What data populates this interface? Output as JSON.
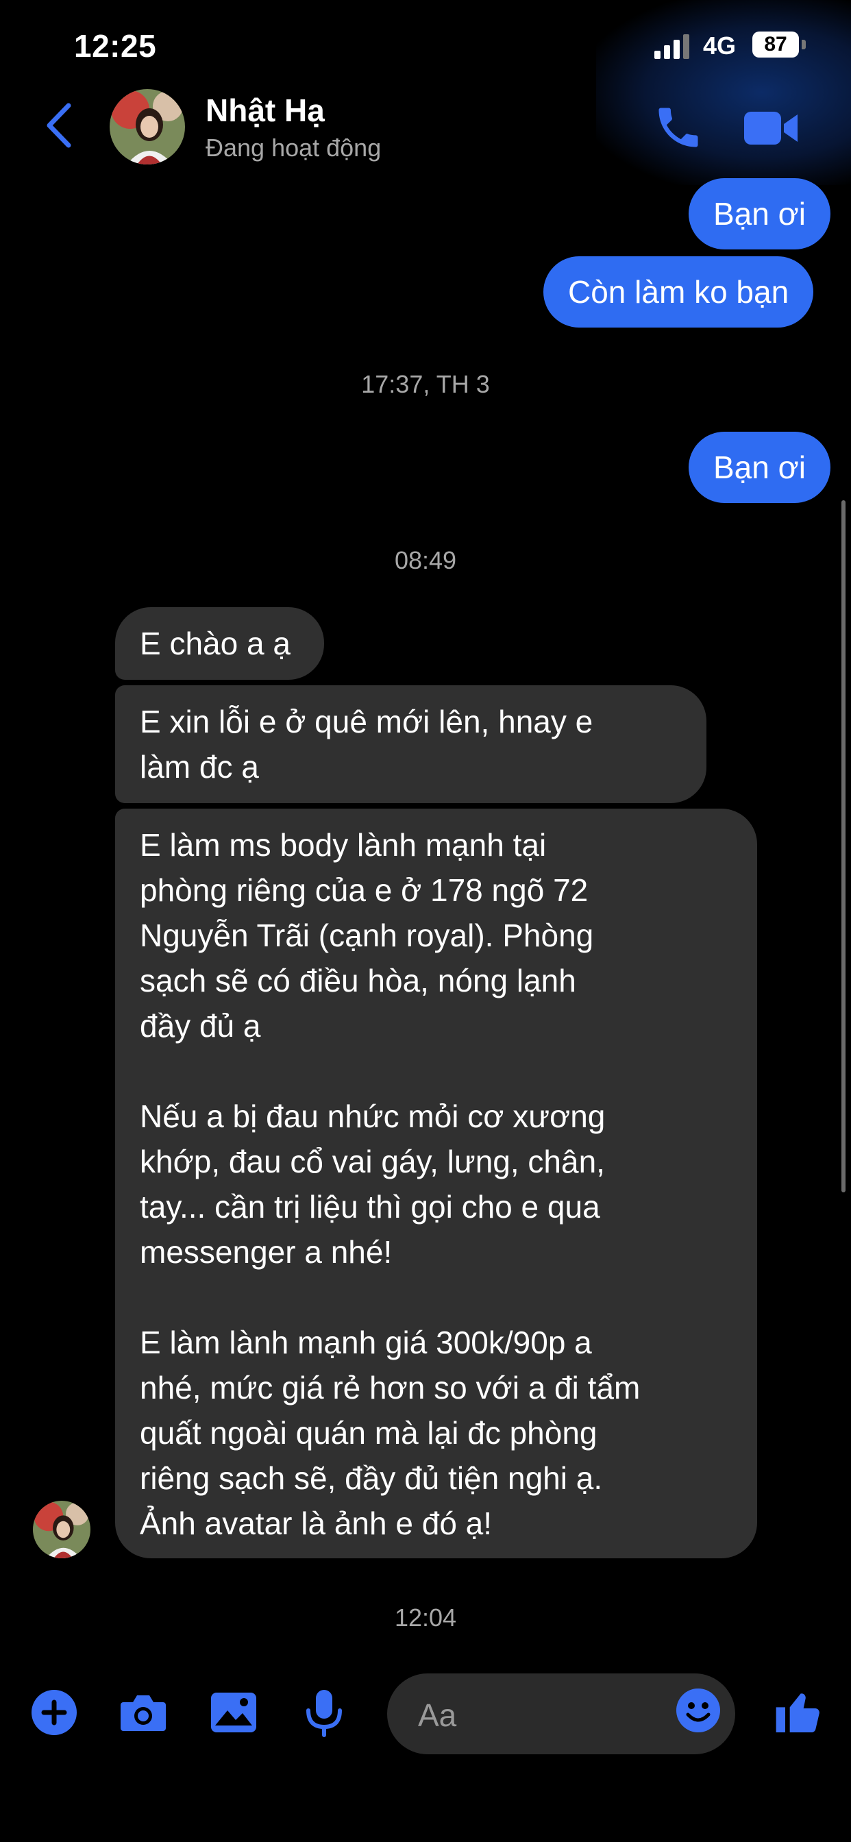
{
  "status_bar": {
    "time": "12:25",
    "network": "4G",
    "battery": "87"
  },
  "header": {
    "contact_name": "Nhật Hạ",
    "contact_status": "Đang hoạt động",
    "icons": [
      "back-icon",
      "phone-icon",
      "video-call-icon"
    ]
  },
  "messages": {
    "sent_1": "Bạn ơi",
    "sent_2": "Còn làm ko bạn",
    "time_1": "17:37, TH 3",
    "sent_3": "Bạn ơi",
    "time_2": "08:49",
    "recv_1": "E chào a ạ",
    "recv_2": "E xin lỗi e ở quê mới lên, hnay e\nlàm đc ạ",
    "recv_3": "E làm ms body lành mạnh tại\nphòng riêng của e ở 178 ngõ 72\nNguyễn Trãi (cạnh royal). Phòng\nsạch sẽ có điều hòa, nóng lạnh\nđầy đủ ạ\n\nNếu a bị đau nhức mỏi cơ xương\nkhớp, đau cổ vai gáy, lưng, chân,\ntay... cần trị liệu thì gọi cho e qua\nmessenger a nhé!\n\nE làm lành mạnh giá 300k/90p a\nnhé, mức giá rẻ hơn so với a đi tẩm\nquất ngoài quán mà lại đc phòng\nriêng sạch sẽ, đầy đủ tiện nghi ạ.\nẢnh avatar là ảnh e đó ạ!",
    "time_3": "12:04"
  },
  "composer": {
    "placeholder": "Aa",
    "icons": [
      "plus-icon",
      "camera-icon",
      "gallery-icon",
      "microphone-icon",
      "emoji-icon",
      "thumbs-up-icon"
    ]
  },
  "colors": {
    "accent": "#2f6cf2",
    "icon_blue": "#3a6ff5",
    "incoming_bubble": "#303030",
    "background": "#000000"
  }
}
